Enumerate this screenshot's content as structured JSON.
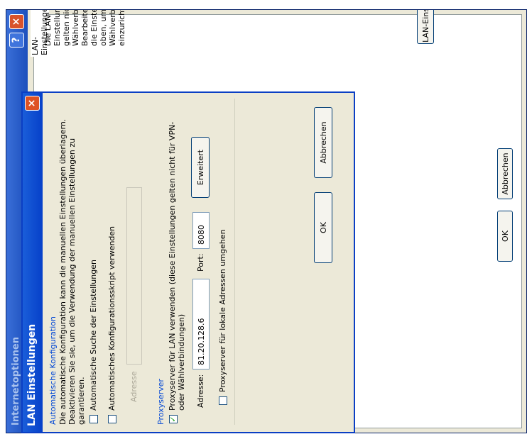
{
  "outer_window": {
    "title": "Internetoptionen",
    "help_glyph": "?",
    "close_glyph": "×",
    "lan_section_title": "LAN-Einstellungen",
    "lan_description": "Die LAN-Einstellungen gelten nicht für Wählverbindungen. Bearbeiten Sie die Einstellungen oben, um Wählverbindungen einzurichten.",
    "lan_settings_button": "LAN-Einstellungen",
    "ok_button": "OK",
    "cancel_button": "Abbrechen"
  },
  "dialog": {
    "title": "LAN Einstellungen",
    "close_glyph": "×",
    "auto_config": {
      "title": "Automatische Konfiguration",
      "description": "Die automatische Konfiguration kann die manuellen Einstellungen überlagern. Deaktivieren Sie sie, um die Verwendung der manuellen Einstellungen zu garantieren.",
      "auto_detect_label": "Automatische Suche der Einstellungen",
      "auto_detect_checked": false,
      "script_label": "Automatisches Konfigurationsskript verwenden",
      "script_checked": false,
      "address_label": "Adresse",
      "address_value": ""
    },
    "proxy": {
      "title": "Proxyserver",
      "use_proxy_label": "Proxyserver für LAN verwenden (diese Einstellungen gelten nicht für VPN- oder Wählverbindungen)",
      "use_proxy_checked": true,
      "address_label": "Adresse:",
      "address_value": "81.20.128.6",
      "port_label": "Port:",
      "port_value": "8080",
      "advanced_button": "Erweitert",
      "bypass_label": "Proxyserver für lokale Adressen umgehen",
      "bypass_checked": false
    },
    "ok_button": "OK",
    "cancel_button": "Abbrechen"
  },
  "colors": {
    "title_bar_blue": "#0640c9",
    "dialog_border": "#0b3fc4",
    "section_title_blue": "#0046d5",
    "close_red": "#de5224",
    "window_bg": "#ece9d8"
  }
}
